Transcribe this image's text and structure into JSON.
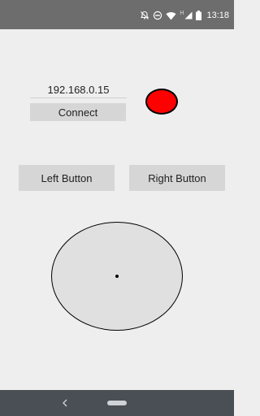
{
  "status_bar": {
    "time": "13:18",
    "icons": [
      "notifications-off-icon",
      "do-not-disturb-icon",
      "wifi-icon",
      "hspa-icon",
      "signal-icon",
      "battery-icon"
    ],
    "network_label": "H"
  },
  "connection": {
    "ip_address": "192.168.0.15",
    "connect_label": "Connect",
    "status_color": "#ff0000"
  },
  "controls": {
    "left_label": "Left Button",
    "right_label": "Right Button"
  },
  "joystick": {
    "knob_icon": "dot-icon"
  },
  "navigation": {
    "back_icon": "chevron-left-icon",
    "home_icon": "home-pill-icon"
  }
}
